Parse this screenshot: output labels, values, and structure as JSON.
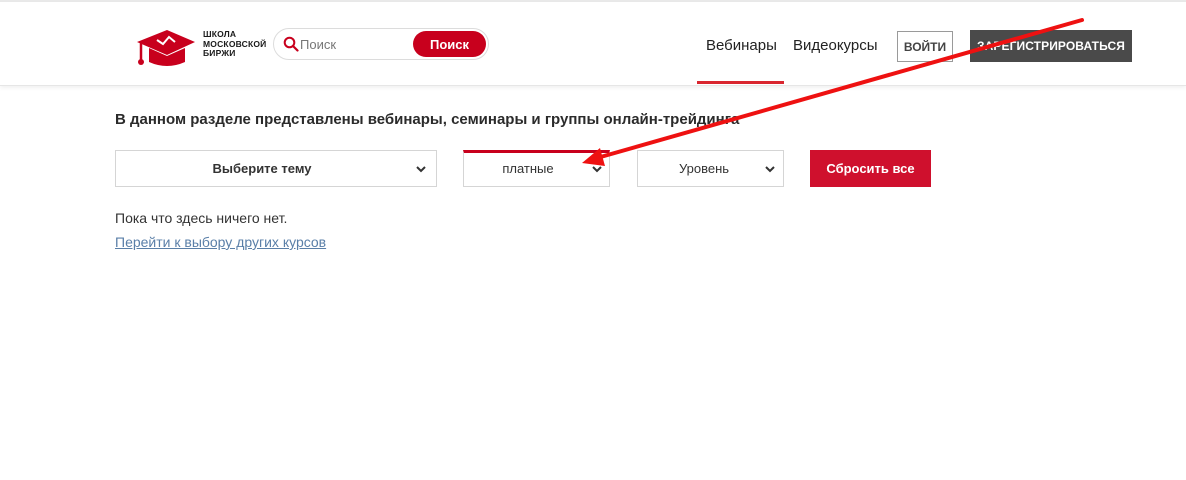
{
  "header": {
    "logo_text": "ШКОЛА\nМОСКОВСКОЙ\nБИРЖИ",
    "search": {
      "placeholder": "Поиск",
      "button_label": "Поиск"
    },
    "nav": [
      {
        "label": "Вебинары",
        "active": true
      },
      {
        "label": "Видеокурсы",
        "active": false
      }
    ],
    "login_label": "ВОЙТИ",
    "register_label": "ЗАРЕГИСТРИРОВАТЬСЯ"
  },
  "main": {
    "intro": "В данном разделе представлены вебинары, семинары и группы онлайн-трейдинга",
    "filters": {
      "topic": "Выберите тему",
      "price": "платные",
      "level": "Уровень",
      "reset_label": "Сбросить все"
    },
    "empty_message": "Пока что здесь ничего нет.",
    "other_courses_link": "Перейти к выбору других курсов"
  },
  "colors": {
    "brand_red": "#c8001d",
    "dark_button": "#4a4a4a",
    "link": "#5a7fa8",
    "annotation_arrow": "#ee1111"
  },
  "icons": [
    "logo-cap-icon",
    "search-icon",
    "chevron-down-icon",
    "annotation-arrow"
  ]
}
